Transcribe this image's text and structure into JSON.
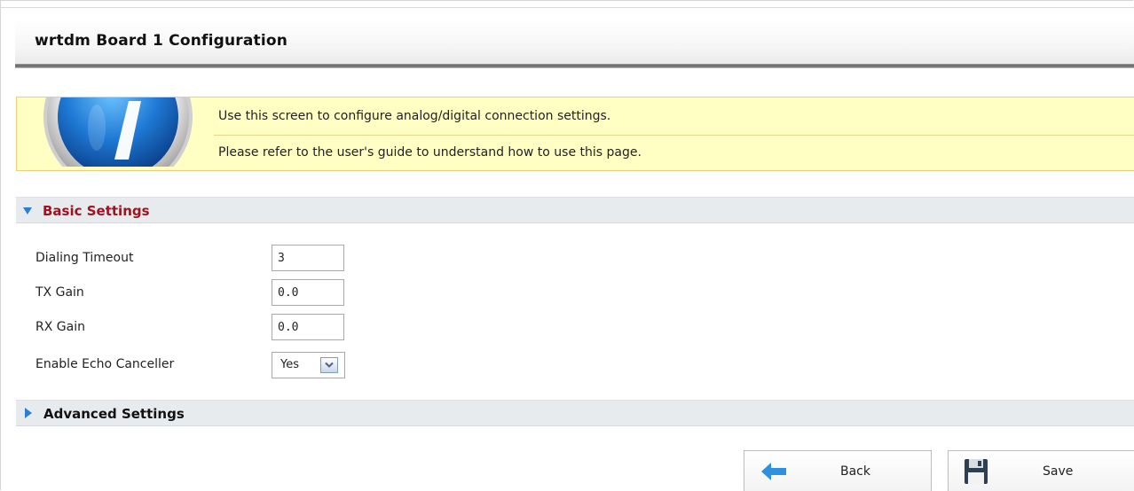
{
  "header": {
    "title": "wrtdm Board 1 Configuration"
  },
  "info": {
    "icon": "info-icon",
    "line1": "Use this screen to configure analog/digital connection settings.",
    "line2": "Please refer to the user's guide to understand how to use this page."
  },
  "basic_settings": {
    "title": "Basic Settings",
    "expanded": true,
    "fields": {
      "dialing_timeout": {
        "label": "Dialing Timeout",
        "value": "3"
      },
      "tx_gain": {
        "label": "TX Gain",
        "value": "0.0"
      },
      "rx_gain": {
        "label": "RX Gain",
        "value": "0.0"
      },
      "echo_canceller": {
        "label": "Enable Echo Canceller",
        "value": "Yes"
      }
    }
  },
  "advanced_settings": {
    "title": "Advanced Settings",
    "expanded": false
  },
  "buttons": {
    "back": {
      "label": "Back",
      "icon": "arrow-left-icon"
    },
    "save": {
      "label": "Save",
      "icon": "floppy-disk-icon"
    }
  },
  "colors": {
    "section_title_active": "#a0121e",
    "arrow": "#2b7fd4",
    "info_background": "#ffffc3",
    "section_bar": "#e8ebee"
  }
}
